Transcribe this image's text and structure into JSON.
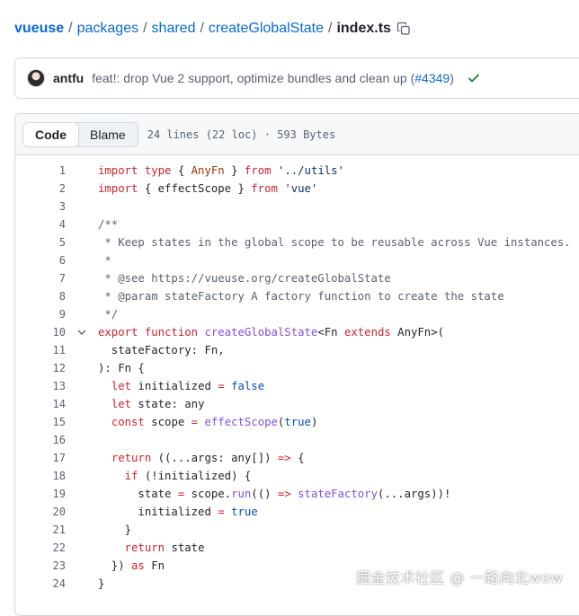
{
  "breadcrumb": {
    "repo": "vueuse",
    "items": [
      "packages",
      "shared",
      "createGlobalState"
    ],
    "current": "index.ts",
    "separator": "/"
  },
  "commit": {
    "author": "antfu",
    "message": "feat!: drop Vue 2 support, optimize bundles and clean up (",
    "link": "#4349",
    "message_end": ")",
    "status": "check-icon"
  },
  "file": {
    "tabs": [
      "Code",
      "Blame"
    ],
    "active_tab": "Code",
    "stats": "24 lines (22 loc) · 593 Bytes"
  },
  "code": {
    "lines": [
      [
        [
          "kw",
          "import type"
        ],
        [
          "src",
          " { "
        ],
        [
          "typ",
          "AnyFn"
        ],
        [
          "src",
          " } "
        ],
        [
          "kw",
          "from"
        ],
        [
          "src",
          " "
        ],
        [
          "str",
          "'../utils'"
        ]
      ],
      [
        [
          "kw",
          "import"
        ],
        [
          "src",
          " { effectScope } "
        ],
        [
          "kw",
          "from"
        ],
        [
          "src",
          " "
        ],
        [
          "str",
          "'vue'"
        ]
      ],
      [],
      [
        [
          "cm",
          "/**"
        ]
      ],
      [
        [
          "cm",
          " * Keep states in the global scope to be reusable across Vue instances."
        ]
      ],
      [
        [
          "cm",
          " *"
        ]
      ],
      [
        [
          "cm",
          " * @see https://vueuse.org/createGlobalState"
        ]
      ],
      [
        [
          "cm",
          " * @param stateFactory A factory function to create the state"
        ]
      ],
      [
        [
          "cm",
          " */"
        ]
      ],
      [
        [
          "kw",
          "export function"
        ],
        [
          "src",
          " "
        ],
        [
          "fn",
          "createGlobalState"
        ],
        [
          "src",
          "<Fn "
        ],
        [
          "kw",
          "extends"
        ],
        [
          "src",
          " AnyFn>("
        ]
      ],
      [
        [
          "src",
          "  stateFactory: Fn,"
        ]
      ],
      [
        [
          "src",
          "): Fn {"
        ]
      ],
      [
        [
          "src",
          "  "
        ],
        [
          "kw",
          "let"
        ],
        [
          "src",
          " initialized "
        ],
        [
          "kw",
          "="
        ],
        [
          "src",
          " "
        ],
        [
          "cst",
          "false"
        ]
      ],
      [
        [
          "src",
          "  "
        ],
        [
          "kw",
          "let"
        ],
        [
          "src",
          " state: any"
        ]
      ],
      [
        [
          "src",
          "  "
        ],
        [
          "kw",
          "const"
        ],
        [
          "src",
          " scope "
        ],
        [
          "kw",
          "="
        ],
        [
          "src",
          " "
        ],
        [
          "fn",
          "effectScope"
        ],
        [
          "src",
          "("
        ],
        [
          "cst",
          "true"
        ],
        [
          "src",
          ")"
        ]
      ],
      [],
      [
        [
          "src",
          "  "
        ],
        [
          "kw",
          "return"
        ],
        [
          "src",
          " ((...args: any[]) "
        ],
        [
          "kw",
          "=>"
        ],
        [
          "src",
          " {"
        ]
      ],
      [
        [
          "src",
          "    "
        ],
        [
          "kw",
          "if"
        ],
        [
          "src",
          " (!initialized) {"
        ]
      ],
      [
        [
          "src",
          "      state "
        ],
        [
          "kw",
          "="
        ],
        [
          "src",
          " scope."
        ],
        [
          "fn",
          "run"
        ],
        [
          "src",
          "(() "
        ],
        [
          "kw",
          "=>"
        ],
        [
          "src",
          " "
        ],
        [
          "fn",
          "stateFactory"
        ],
        [
          "src",
          "(...args))!"
        ]
      ],
      [
        [
          "src",
          "      initialized "
        ],
        [
          "kw",
          "="
        ],
        [
          "src",
          " "
        ],
        [
          "cst",
          "true"
        ]
      ],
      [
        [
          "src",
          "    }"
        ]
      ],
      [
        [
          "src",
          "    "
        ],
        [
          "kw",
          "return"
        ],
        [
          "src",
          " state"
        ]
      ],
      [
        [
          "src",
          "  }) "
        ],
        [
          "kw",
          "as"
        ],
        [
          "src",
          " Fn"
        ]
      ],
      [
        [
          "src",
          "}"
        ]
      ]
    ],
    "fold_line": 10
  },
  "watermark": "掘金技术社区 @ 一路向北wow",
  "colors": {
    "link": "#0969da",
    "keyword": "#cf222e",
    "function": "#8250df",
    "string": "#0a3069",
    "comment": "#59636e",
    "constant": "#0550ae",
    "success": "#1a7f37"
  }
}
